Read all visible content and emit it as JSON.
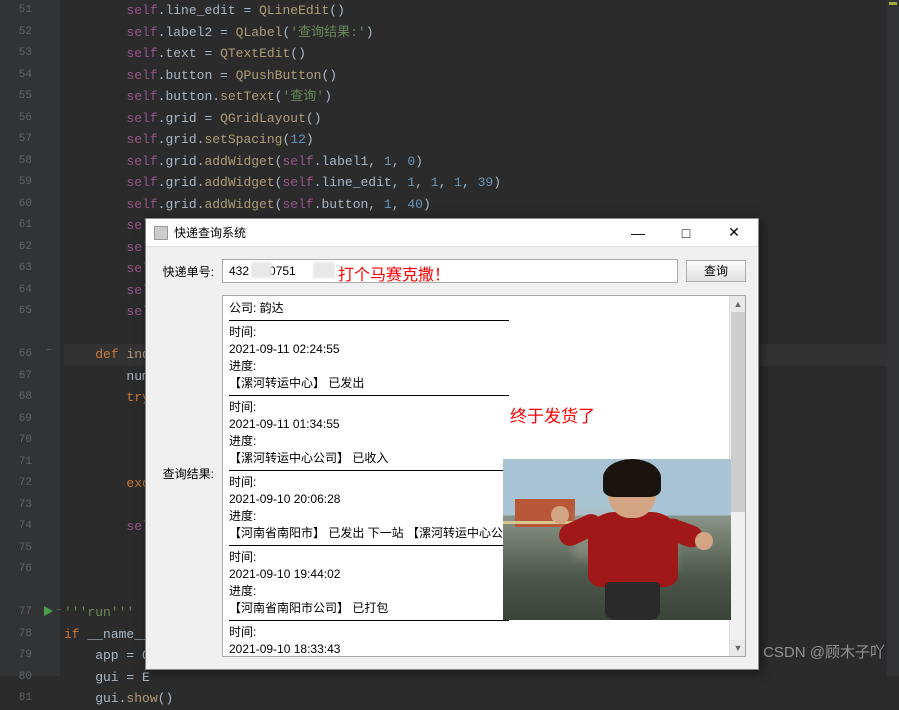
{
  "editor": {
    "line_numbers": [
      "51",
      "52",
      "53",
      "54",
      "55",
      "56",
      "57",
      "58",
      "59",
      "60",
      "61",
      "62",
      "63",
      "64",
      "65",
      "",
      "66",
      "67",
      "68",
      "69",
      "70",
      "71",
      "72",
      "73",
      "74",
      "75",
      "76",
      "",
      "77",
      "78",
      "79",
      "80",
      "81"
    ],
    "code_lines": [
      {
        "indent": 8,
        "tokens": [
          {
            "t": "self",
            "c": "self"
          },
          {
            "t": "plain",
            "c": ".line_edit = "
          },
          {
            "t": "fn",
            "c": "QLineEdit"
          },
          {
            "t": "plain",
            "c": "()"
          }
        ]
      },
      {
        "indent": 8,
        "tokens": [
          {
            "t": "self",
            "c": "self"
          },
          {
            "t": "plain",
            "c": ".label2 = "
          },
          {
            "t": "fn",
            "c": "QLabel"
          },
          {
            "t": "plain",
            "c": "("
          },
          {
            "t": "str",
            "c": "'查询结果:'"
          },
          {
            "t": "plain",
            "c": ")"
          }
        ]
      },
      {
        "indent": 8,
        "tokens": [
          {
            "t": "self",
            "c": "self"
          },
          {
            "t": "plain",
            "c": ".text = "
          },
          {
            "t": "fn",
            "c": "QTextEdit"
          },
          {
            "t": "plain",
            "c": "()"
          }
        ]
      },
      {
        "indent": 8,
        "tokens": [
          {
            "t": "self",
            "c": "self"
          },
          {
            "t": "plain",
            "c": ".button = "
          },
          {
            "t": "fn",
            "c": "QPushButton"
          },
          {
            "t": "plain",
            "c": "()"
          }
        ]
      },
      {
        "indent": 8,
        "tokens": [
          {
            "t": "self",
            "c": "self"
          },
          {
            "t": "plain",
            "c": ".button."
          },
          {
            "t": "fn",
            "c": "setText"
          },
          {
            "t": "plain",
            "c": "("
          },
          {
            "t": "str",
            "c": "'查询'"
          },
          {
            "t": "plain",
            "c": ")"
          }
        ]
      },
      {
        "indent": 8,
        "tokens": [
          {
            "t": "self",
            "c": "self"
          },
          {
            "t": "plain",
            "c": ".grid = "
          },
          {
            "t": "fn",
            "c": "QGridLayout"
          },
          {
            "t": "plain",
            "c": "()"
          }
        ]
      },
      {
        "indent": 8,
        "tokens": [
          {
            "t": "self",
            "c": "self"
          },
          {
            "t": "plain",
            "c": ".grid."
          },
          {
            "t": "fn",
            "c": "setSpacing"
          },
          {
            "t": "plain",
            "c": "("
          },
          {
            "t": "num",
            "c": "12"
          },
          {
            "t": "plain",
            "c": ")"
          }
        ]
      },
      {
        "indent": 8,
        "tokens": [
          {
            "t": "self",
            "c": "self"
          },
          {
            "t": "plain",
            "c": ".grid."
          },
          {
            "t": "fn",
            "c": "addWidget"
          },
          {
            "t": "plain",
            "c": "("
          },
          {
            "t": "self",
            "c": "self"
          },
          {
            "t": "plain",
            "c": ".label1, "
          },
          {
            "t": "num",
            "c": "1"
          },
          {
            "t": "plain",
            "c": ", "
          },
          {
            "t": "num",
            "c": "0"
          },
          {
            "t": "plain",
            "c": ")"
          }
        ]
      },
      {
        "indent": 8,
        "tokens": [
          {
            "t": "self",
            "c": "self"
          },
          {
            "t": "plain",
            "c": ".grid."
          },
          {
            "t": "fn",
            "c": "addWidget"
          },
          {
            "t": "plain",
            "c": "("
          },
          {
            "t": "self",
            "c": "self"
          },
          {
            "t": "plain",
            "c": ".line_edit, "
          },
          {
            "t": "num",
            "c": "1"
          },
          {
            "t": "plain",
            "c": ", "
          },
          {
            "t": "num",
            "c": "1"
          },
          {
            "t": "plain",
            "c": ", "
          },
          {
            "t": "num",
            "c": "1"
          },
          {
            "t": "plain",
            "c": ", "
          },
          {
            "t": "num",
            "c": "39"
          },
          {
            "t": "plain",
            "c": ")"
          }
        ]
      },
      {
        "indent": 8,
        "tokens": [
          {
            "t": "self",
            "c": "self"
          },
          {
            "t": "plain",
            "c": ".grid."
          },
          {
            "t": "fn",
            "c": "addWidget"
          },
          {
            "t": "plain",
            "c": "("
          },
          {
            "t": "self",
            "c": "self"
          },
          {
            "t": "plain",
            "c": ".button, "
          },
          {
            "t": "num",
            "c": "1"
          },
          {
            "t": "plain",
            "c": ", "
          },
          {
            "t": "num",
            "c": "40"
          },
          {
            "t": "plain",
            "c": ")"
          }
        ]
      },
      {
        "indent": 8,
        "tokens": [
          {
            "t": "self",
            "c": "sel"
          }
        ]
      },
      {
        "indent": 8,
        "tokens": [
          {
            "t": "self",
            "c": "sel"
          }
        ]
      },
      {
        "indent": 8,
        "tokens": [
          {
            "t": "self",
            "c": "sel"
          }
        ]
      },
      {
        "indent": 8,
        "tokens": [
          {
            "t": "self",
            "c": "sel"
          }
        ]
      },
      {
        "indent": 8,
        "tokens": [
          {
            "t": "self",
            "c": "sel"
          }
        ]
      },
      {
        "indent": 0,
        "tokens": []
      },
      {
        "indent": 4,
        "tokens": [
          {
            "t": "kw",
            "c": "def "
          },
          {
            "t": "fn",
            "c": "inq"
          }
        ]
      },
      {
        "indent": 8,
        "tokens": [
          {
            "t": "plain",
            "c": "num"
          }
        ]
      },
      {
        "indent": 8,
        "tokens": [
          {
            "t": "kw",
            "c": "try"
          }
        ]
      },
      {
        "indent": 0,
        "tokens": []
      },
      {
        "indent": 0,
        "tokens": []
      },
      {
        "indent": 0,
        "tokens": []
      },
      {
        "indent": 8,
        "tokens": [
          {
            "t": "kw",
            "c": "exc"
          }
        ]
      },
      {
        "indent": 0,
        "tokens": []
      },
      {
        "indent": 8,
        "tokens": [
          {
            "t": "self",
            "c": "sel"
          }
        ]
      },
      {
        "indent": 0,
        "tokens": []
      },
      {
        "indent": 0,
        "tokens": []
      },
      {
        "indent": 0,
        "tokens": []
      },
      {
        "indent": 0,
        "tokens": [
          {
            "t": "str",
            "c": "'''run'''"
          }
        ]
      },
      {
        "indent": 0,
        "tokens": [
          {
            "t": "kw",
            "c": "if"
          },
          {
            "t": "plain",
            "c": " __name__"
          }
        ]
      },
      {
        "indent": 4,
        "tokens": [
          {
            "t": "plain",
            "c": "app = Q"
          }
        ]
      },
      {
        "indent": 4,
        "tokens": [
          {
            "t": "plain",
            "c": "gui = E"
          }
        ]
      },
      {
        "indent": 4,
        "tokens": [
          {
            "t": "plain",
            "c": "gui."
          },
          {
            "t": "fn",
            "c": "show"
          },
          {
            "t": "plain",
            "c": "()"
          }
        ]
      }
    ]
  },
  "dialog": {
    "title": "快递查询系统",
    "label_number": "快递单号:",
    "input_value": "432    50751",
    "mosaic_note": "打个马赛克撒！",
    "query_button": "查询",
    "label_result": "查询结果:",
    "finally_note": "终于发货了",
    "result_company": "公司: 韵达",
    "entries": [
      {
        "time_label": "时间:",
        "time": "2021-09-11 02:24:55",
        "progress_label": "进度:",
        "progress": "【漯河转运中心】 已发出"
      },
      {
        "time_label": "时间:",
        "time": "2021-09-11 01:34:55",
        "progress_label": "进度:",
        "progress": "【漯河转运中心公司】 已收入"
      },
      {
        "time_label": "时间:",
        "time": "2021-09-10 20:06:28",
        "progress_label": "进度:",
        "progress": "【河南省南阳市】 已发出 下一站 【漯河转运中心公"
      },
      {
        "time_label": "时间:",
        "time": "2021-09-10 19:44:02",
        "progress_label": "进度:",
        "progress": "【河南省南阳市公司】 已打包"
      },
      {
        "time_label": "时间:",
        "time": "2021-09-10 18:33:43",
        "progress_label": "",
        "progress": ""
      }
    ]
  },
  "watermark": "CSDN @顾木子吖"
}
